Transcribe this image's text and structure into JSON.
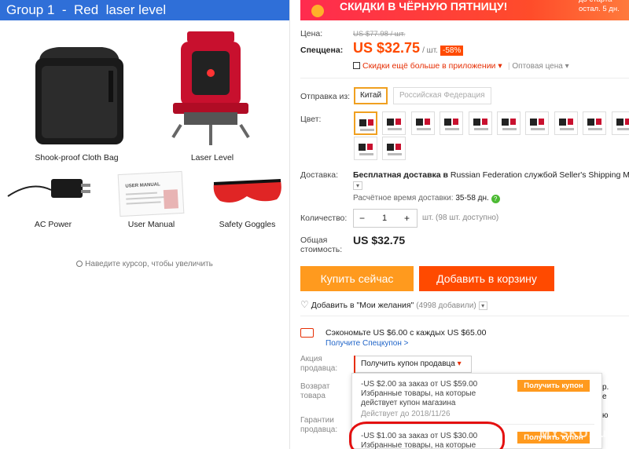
{
  "left": {
    "banner": "Group 1  -  Red  laser level",
    "items": [
      "Shook-proof Cloth Bag",
      "Laser Level",
      "AC Power",
      "User Manual",
      "Safety Goggles"
    ],
    "manual_header": "USER MANUAL",
    "hint": "Наведите курсор, чтобы увеличить"
  },
  "promo": {
    "text": "СКИДКИ В ЧЁРНУЮ ПЯТНИЦУ!",
    "side": "до старта остал. 5 дн."
  },
  "price": {
    "price_label": "Цена:",
    "old": "US $77.98 / шт.",
    "special_label": "Спеццена:",
    "current": "US $32.75",
    "unit": "/ шт.",
    "discount": "-58%",
    "app_deal": "Скидки ещё больше в приложении",
    "wholesale": "Оптовая цена"
  },
  "ship_from": {
    "label": "Отправка из:",
    "options": [
      "Китай",
      "Российская Федерация"
    ]
  },
  "color": {
    "label": "Цвет:",
    "count": 15
  },
  "delivery": {
    "label": "Доставка:",
    "text_bold": "Бесплатная доставка в",
    "text": "Russian Federation службой Seller's Shipping Met",
    "eta_label": "Расчётное время доставки:",
    "eta": "35-58 дн."
  },
  "quantity": {
    "label": "Количество:",
    "minus": "−",
    "value": "1",
    "plus": "+",
    "note": "шт. (98 шт. доступно)"
  },
  "total": {
    "label": "Общая стоимость:",
    "value": "US $32.75"
  },
  "buttons": {
    "buy": "Купить сейчас",
    "cart": "Добавить в корзину"
  },
  "wishlist": {
    "text": "Добавить в \"Мои желания\"",
    "count": "(4998 добавили)"
  },
  "coupon": {
    "save": "Сэкономьте US $6.00 с каждых US $65.00",
    "get": "Получите Спецкупон >"
  },
  "seller": {
    "promo_label": "Акция продавца:",
    "dropdown": "Получить купон продавца",
    "return_label": "Возврат товара",
    "guarantee_label": "Гарантии продавца:",
    "right_frag1": "р.",
    "right_frag2": "е",
    "right_frag3": "ю"
  },
  "coupons": [
    {
      "amount": "-US $2.00 за заказ от US $59.00",
      "desc": "Избранные товары, на которые действует купон магазина",
      "valid": "Действует до 2018/11/26",
      "btn": "Получить купон"
    },
    {
      "amount": "-US $1.00 за заказ от US $30.00",
      "desc": "Избранные товары, на которые",
      "btn": "Получить купон"
    }
  ],
  "watermark": "MYSKU.ru",
  "colors": {
    "accent": "#ff4a00",
    "orange": "#ff9a1e",
    "blue": "#2f6fd8",
    "red": "#e62e04"
  }
}
